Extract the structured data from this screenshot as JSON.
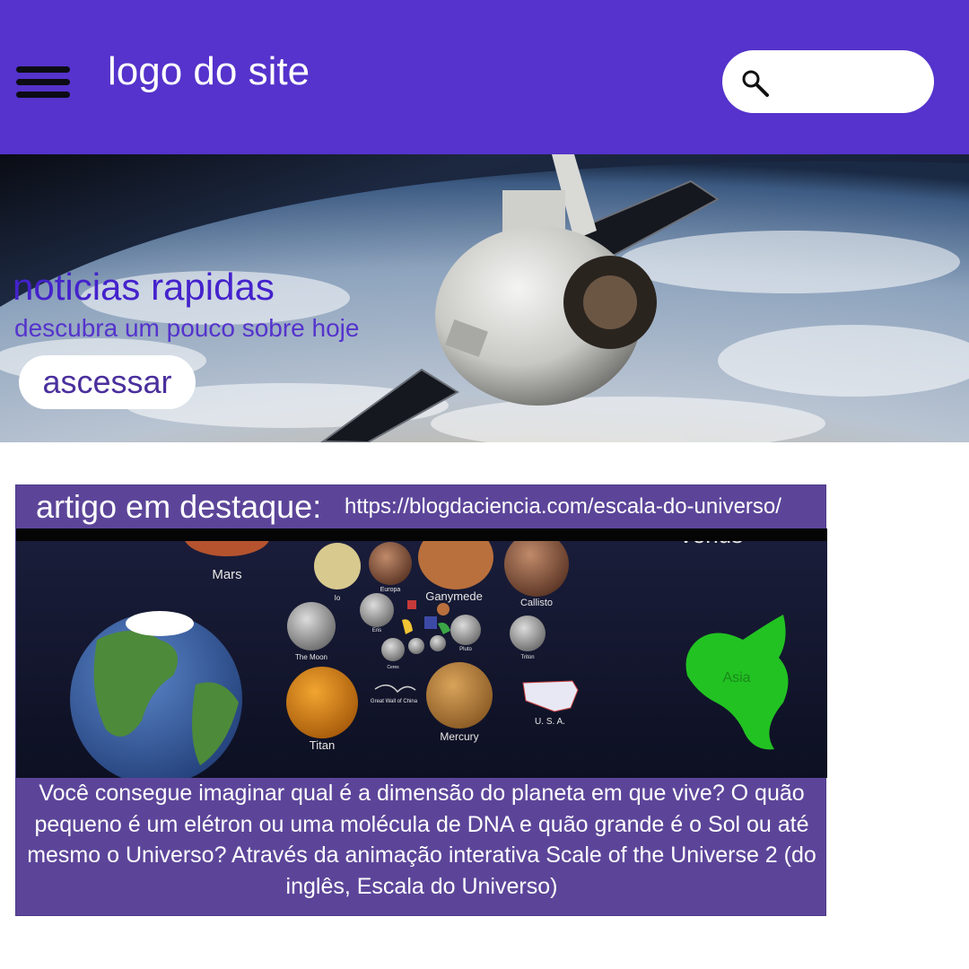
{
  "header": {
    "logo_text": "logo do site",
    "menu_icon": "hamburger-menu-icon",
    "search": {
      "icon": "magnifier-icon",
      "placeholder": "",
      "value": ""
    },
    "background_color": "#5533cc"
  },
  "hero": {
    "title": "noticias rapidas",
    "subtitle": "descubra um pouco sobre hoje",
    "button_label": "ascessar",
    "title_color": "#4422cc"
  },
  "featured": {
    "label": "artigo em destaque:",
    "url": "https://blogdaciencia.com/escala-do-universo/",
    "image_labels": {
      "mars": "Mars",
      "io": "Io",
      "europa": "Europa",
      "ganymede": "Ganymede",
      "callisto": "Callisto",
      "venus": "Venus",
      "moon": "The Moon",
      "eris": "Eris",
      "pluto": "Pluto",
      "triton": "Triton",
      "ceres": "Ceres",
      "great_wall": "Great Wall of China",
      "titan": "Titan",
      "mercury": "Mercury",
      "usa": "U. S. A.",
      "asia": "Asia"
    },
    "text": "Você consegue imaginar qual é a dimensão do planeta em que vive? O quão pequeno é um elétron ou uma molécula de DNA e quão grande é o Sol ou até mesmo o Universo? Através da animação interativa Scale of the Universe 2 (do inglês, Escala do Universo)",
    "background_color": "#5c4599"
  }
}
